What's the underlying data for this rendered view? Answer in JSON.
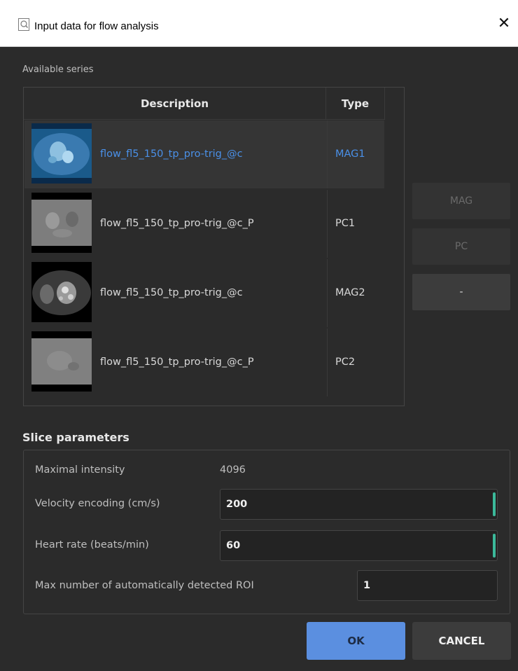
{
  "window": {
    "title": "Input data for flow analysis",
    "close_symbol": "✕",
    "icon": "search-document-icon"
  },
  "series": {
    "section_label": "Available series",
    "columns": {
      "description": "Description",
      "type": "Type"
    },
    "rows": [
      {
        "description": "flow_fl5_150_tp_pro-trig_@c",
        "type": "MAG1",
        "selected": true,
        "thumb": "magnitude-image"
      },
      {
        "description": "flow_fl5_150_tp_pro-trig_@c_P",
        "type": "PC1",
        "selected": false,
        "thumb": "phase-image"
      },
      {
        "description": "flow_fl5_150_tp_pro-trig_@c",
        "type": "MAG2",
        "selected": false,
        "thumb": "magnitude-image"
      },
      {
        "description": "flow_fl5_150_tp_pro-trig_@c_P",
        "type": "PC2",
        "selected": false,
        "thumb": "phase-image"
      }
    ]
  },
  "assign_buttons": {
    "mag": "MAG",
    "pc": "PC",
    "none": "-"
  },
  "slice": {
    "title": "Slice parameters",
    "max_intensity_label": "Maximal intensity",
    "max_intensity_value": "4096",
    "venc_label": "Velocity encoding (cm/s)",
    "venc_value": "200",
    "heart_rate_label": "Heart rate (beats/min)",
    "heart_rate_value": "60",
    "max_roi_label": "Max number of automatically detected ROI",
    "max_roi_value": "1"
  },
  "footer": {
    "ok": "OK",
    "cancel": "CANCEL"
  },
  "colors": {
    "accent_blue": "#4a90e8",
    "ok_button": "#5b8fe0",
    "input_accent": "#3bb99a",
    "background": "#2b2b2b"
  }
}
